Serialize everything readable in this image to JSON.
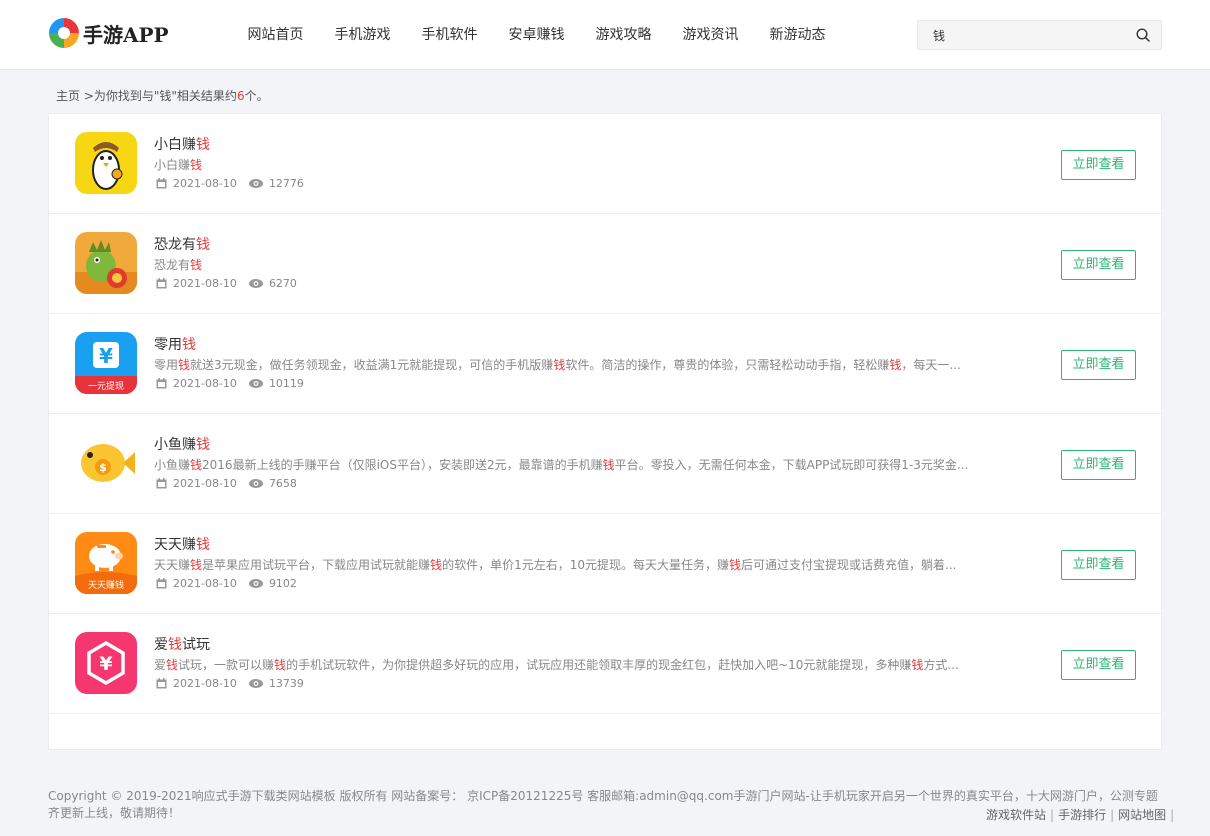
{
  "header": {
    "logo_text": "手游APP",
    "nav": [
      "网站首页",
      "手机游戏",
      "手机软件",
      "安卓赚钱",
      "游戏攻略",
      "游戏资讯",
      "新游动态"
    ],
    "search_value": "钱"
  },
  "breadcrumb": {
    "home": "主页",
    "prefix": " >为你找到与\"钱\"相关结果约",
    "count": "6",
    "suffix": "个。"
  },
  "items": [
    {
      "title": [
        {
          "t": "小白赚"
        },
        {
          "t": "钱",
          "hl": true
        }
      ],
      "desc": [
        {
          "t": "小白赚"
        },
        {
          "t": "钱",
          "hl": true
        }
      ],
      "date": "2021-08-10",
      "views": "12776",
      "button": "立即查看",
      "icon": "penguin-app-icon"
    },
    {
      "title": [
        {
          "t": "恐龙有"
        },
        {
          "t": "钱",
          "hl": true
        }
      ],
      "desc": [
        {
          "t": "恐龙有"
        },
        {
          "t": "钱",
          "hl": true
        }
      ],
      "date": "2021-08-10",
      "views": "6270",
      "button": "立即查看",
      "icon": "dinosaur-app-icon"
    },
    {
      "title": [
        {
          "t": "零用"
        },
        {
          "t": "钱",
          "hl": true
        }
      ],
      "desc": [
        {
          "t": "零用"
        },
        {
          "t": "钱",
          "hl": true
        },
        {
          "t": "就送3元现金，做任务领现金，收益满1元就能提现，可信的手机版赚"
        },
        {
          "t": "钱",
          "hl": true
        },
        {
          "t": "软件。简洁的操作，尊贵的体验，只需轻松动动手指，轻松赚"
        },
        {
          "t": "钱",
          "hl": true
        },
        {
          "t": "，每天一..."
        }
      ],
      "date": "2021-08-10",
      "views": "10119",
      "button": "立即查看",
      "icon": "yuan-app-icon",
      "icon_label": "一元提现"
    },
    {
      "title": [
        {
          "t": "小鱼赚"
        },
        {
          "t": "钱",
          "hl": true
        }
      ],
      "desc": [
        {
          "t": "小鱼赚"
        },
        {
          "t": "钱",
          "hl": true
        },
        {
          "t": "2016最新上线的手赚平台（仅限iOS平台），安装即送2元，最靠谱的手机赚"
        },
        {
          "t": "钱",
          "hl": true
        },
        {
          "t": "平台。零投入，无需任何本金，下载APP试玩即可获得1-3元奖金..."
        }
      ],
      "date": "2021-08-10",
      "views": "7658",
      "button": "立即查看",
      "icon": "fish-app-icon"
    },
    {
      "title": [
        {
          "t": "天天赚"
        },
        {
          "t": "钱",
          "hl": true
        }
      ],
      "desc": [
        {
          "t": "天天赚"
        },
        {
          "t": "钱",
          "hl": true
        },
        {
          "t": "是苹果应用试玩平台，下载应用试玩就能赚"
        },
        {
          "t": "钱",
          "hl": true
        },
        {
          "t": "的软件，单价1元左右，10元提现。每天大量任务，赚"
        },
        {
          "t": "钱",
          "hl": true
        },
        {
          "t": "后可通过支付宝提现或话费充值，躺着..."
        }
      ],
      "date": "2021-08-10",
      "views": "9102",
      "button": "立即查看",
      "icon": "piggy-bank-app-icon",
      "icon_label": "天天赚钱"
    },
    {
      "title": [
        {
          "t": "爱"
        },
        {
          "t": "钱",
          "hl": true
        },
        {
          "t": "试玩"
        }
      ],
      "desc": [
        {
          "t": "爱"
        },
        {
          "t": "钱",
          "hl": true
        },
        {
          "t": "试玩，一款可以赚"
        },
        {
          "t": "钱",
          "hl": true
        },
        {
          "t": "的手机试玩软件，为你提供超多好玩的应用，试玩应用还能领取丰厚的现金红包，赶快加入吧~10元就能提现，多种赚"
        },
        {
          "t": "钱",
          "hl": true
        },
        {
          "t": "方式..."
        }
      ],
      "date": "2021-08-10",
      "views": "13739",
      "button": "立即查看",
      "icon": "hexagon-yuan-app-icon"
    }
  ],
  "footer": {
    "copyright": "Copyright © 2019-2021响应式手游下载类网站模板 版权所有 网站备案号： 京ICP备20121225号 客服邮箱:admin@qq.com手游门户网站-让手机玩家开启另一个世界的真实平台，十大网游门户，公测专题齐更新上线，敬请期待！",
    "links": [
      "游戏软件站",
      "手游排行",
      "网站地图"
    ]
  },
  "colors": {
    "accent_green": "#2bb673",
    "highlight_red": "#e83a3a"
  }
}
